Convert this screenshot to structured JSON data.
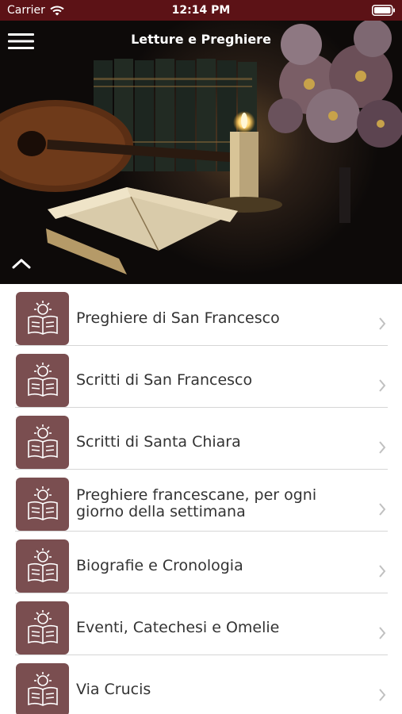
{
  "status_bar": {
    "carrier": "Carrier",
    "time": "12:14 PM"
  },
  "header": {
    "title": "Letture e Preghiere"
  },
  "icons": {
    "menu": "hamburger-menu-icon",
    "collapse": "chevron-up-icon",
    "row_thumb": "open-book-sun-icon",
    "row_chevron": "chevron-right-icon"
  },
  "colors": {
    "status_bar": "#5c1216",
    "thumb": "#7a4e50",
    "text": "#333333",
    "divider": "#d6d6d6"
  },
  "list": {
    "items": [
      {
        "label": "Preghiere di San Francesco"
      },
      {
        "label": "Scritti di San Francesco"
      },
      {
        "label": "Scritti di Santa Chiara"
      },
      {
        "label": "Preghiere francescane, per ogni giorno della settimana"
      },
      {
        "label": "Biografie e Cronologia"
      },
      {
        "label": "Eventi, Catechesi e Omelie"
      },
      {
        "label": "Via Crucis"
      }
    ]
  }
}
